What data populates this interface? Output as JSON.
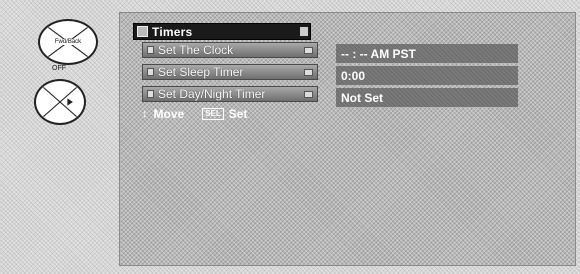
{
  "remote": {
    "top_button_label": "Fwd/Back",
    "off_label": "OFF",
    "bottom_button_arrow": "▶"
  },
  "menu": {
    "title": "Timers",
    "items": [
      {
        "label": "Set The Clock",
        "value": "-- : -- AM PST"
      },
      {
        "label": "Set Sleep Timer",
        "value": "0:00"
      },
      {
        "label": "Set Day/Night Timer",
        "value": "Not Set"
      }
    ]
  },
  "hint": {
    "updown_icon": "↕",
    "move_label": "Move",
    "sel_key": "SEL",
    "set_label": "Set"
  }
}
